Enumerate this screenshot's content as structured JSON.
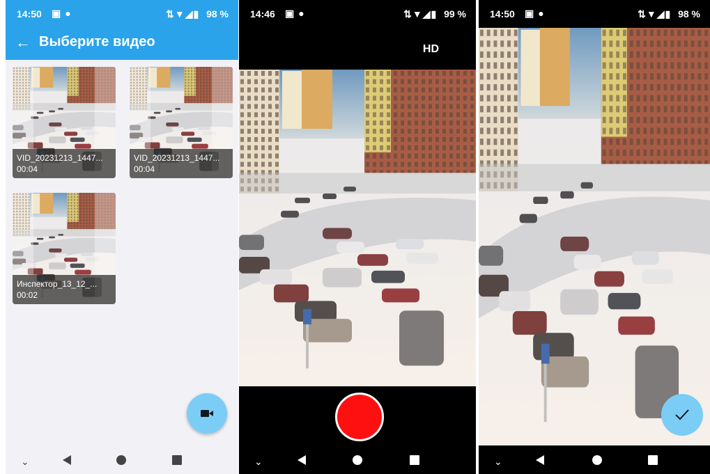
{
  "gallery": {
    "status": {
      "time": "14:50",
      "battery": "98 %"
    },
    "title": "Выберите видео",
    "videos": [
      {
        "name": "VID_20231213_1447...",
        "duration": "00:04"
      },
      {
        "name": "VID_20231213_1447...",
        "duration": "00:04"
      },
      {
        "name": "Инспектор_13_12_...",
        "duration": "00:02"
      }
    ],
    "fab_icon": "videocam-icon"
  },
  "camera": {
    "status": {
      "time": "14:46",
      "battery": "99 %"
    },
    "quality_label": "HD",
    "record_icon": "record-icon"
  },
  "preview": {
    "status": {
      "time": "14:50",
      "battery": "98 %"
    },
    "confirm_icon": "check-icon"
  },
  "navbar": {
    "icons": [
      "chevron-down-icon",
      "back-triangle-icon",
      "home-circle-icon",
      "recents-square-icon"
    ]
  },
  "colors": {
    "appbar": "#2aa3ea",
    "fab": "#7ccdf6",
    "record": "#ff1010",
    "background": "#f2f1f6"
  }
}
